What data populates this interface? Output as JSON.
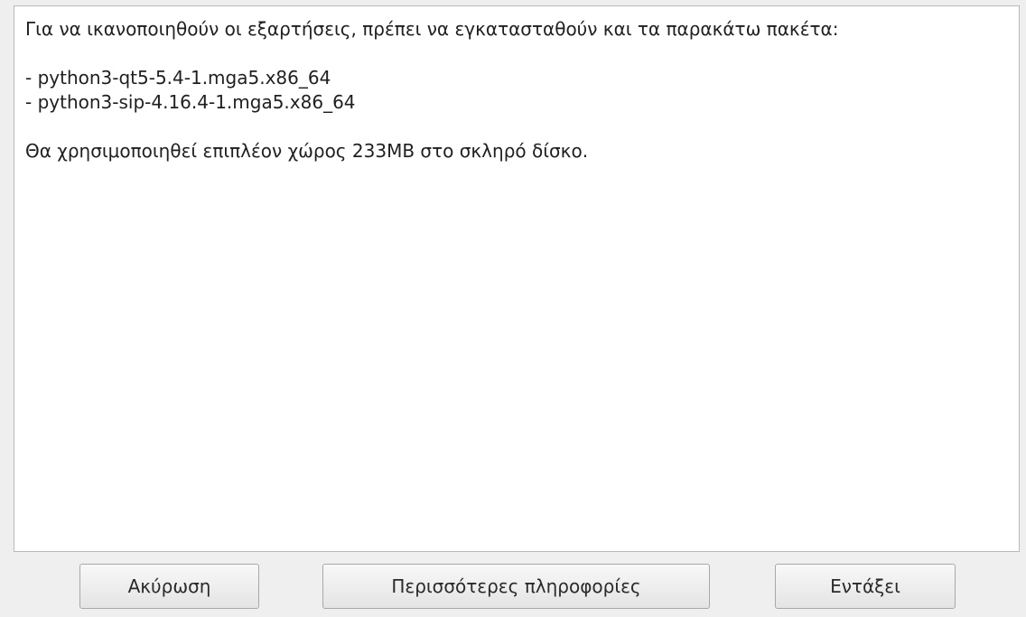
{
  "message": {
    "intro": "Για να ικανοποιηθούν οι εξαρτήσεις, πρέπει να εγκατασταθούν και τα παρακάτω πακέτα:",
    "packages": [
      "- python3-qt5-5.4-1.mga5.x86_64",
      "- python3-sip-4.16.4-1.mga5.x86_64"
    ],
    "space_note": "Θα χρησιμοποιηθεί επιπλέον χώρος 233MB στο σκληρό δίσκο."
  },
  "buttons": {
    "cancel": "Ακύρωση",
    "more_info": "Περισσότερες πληροφορίες",
    "ok": "Εντάξει"
  }
}
